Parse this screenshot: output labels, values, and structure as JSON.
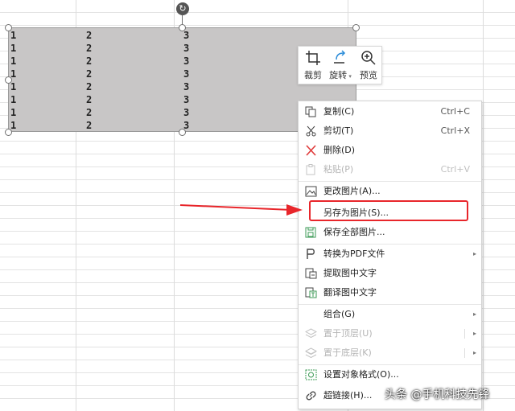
{
  "picture": {
    "rows": [
      [
        "1",
        "2",
        "3"
      ],
      [
        "1",
        "2",
        "3"
      ],
      [
        "1",
        "2",
        "3"
      ],
      [
        "1",
        "2",
        "3"
      ],
      [
        "1",
        "2",
        "3"
      ],
      [
        "1",
        "2",
        "3"
      ],
      [
        "1",
        "2",
        "3"
      ],
      [
        "1",
        "2",
        "3"
      ]
    ]
  },
  "mini_toolbar": {
    "crop": "裁剪",
    "rotate": "旋转",
    "preview": "预览"
  },
  "context_menu": {
    "copy": {
      "label": "复制(C)",
      "shortcut": "Ctrl+C"
    },
    "cut": {
      "label": "剪切(T)",
      "shortcut": "Ctrl+X"
    },
    "delete": {
      "label": "删除(D)"
    },
    "paste": {
      "label": "粘贴(P)",
      "shortcut": "Ctrl+V"
    },
    "change_picture": {
      "label": "更改图片(A)..."
    },
    "save_as_picture": {
      "label": "另存为图片(S)..."
    },
    "save_all_pictures": {
      "label": "保存全部图片..."
    },
    "convert_pdf": {
      "label": "转换为PDF文件"
    },
    "extract_text": {
      "label": "提取图中文字"
    },
    "translate_text": {
      "label": "翻译图中文字"
    },
    "group": {
      "label": "组合(G)"
    },
    "bring_to_front": {
      "label": "置于顶层(U)"
    },
    "send_to_back": {
      "label": "置于底层(K)"
    },
    "format_object": {
      "label": "设置对象格式(O)..."
    },
    "hyperlink": {
      "label": "超链接(H)..."
    }
  },
  "watermark": "头条 @手机科技先锋",
  "colors": {
    "highlight": "#e8262b",
    "picture_fill": "#c8c6c6"
  }
}
